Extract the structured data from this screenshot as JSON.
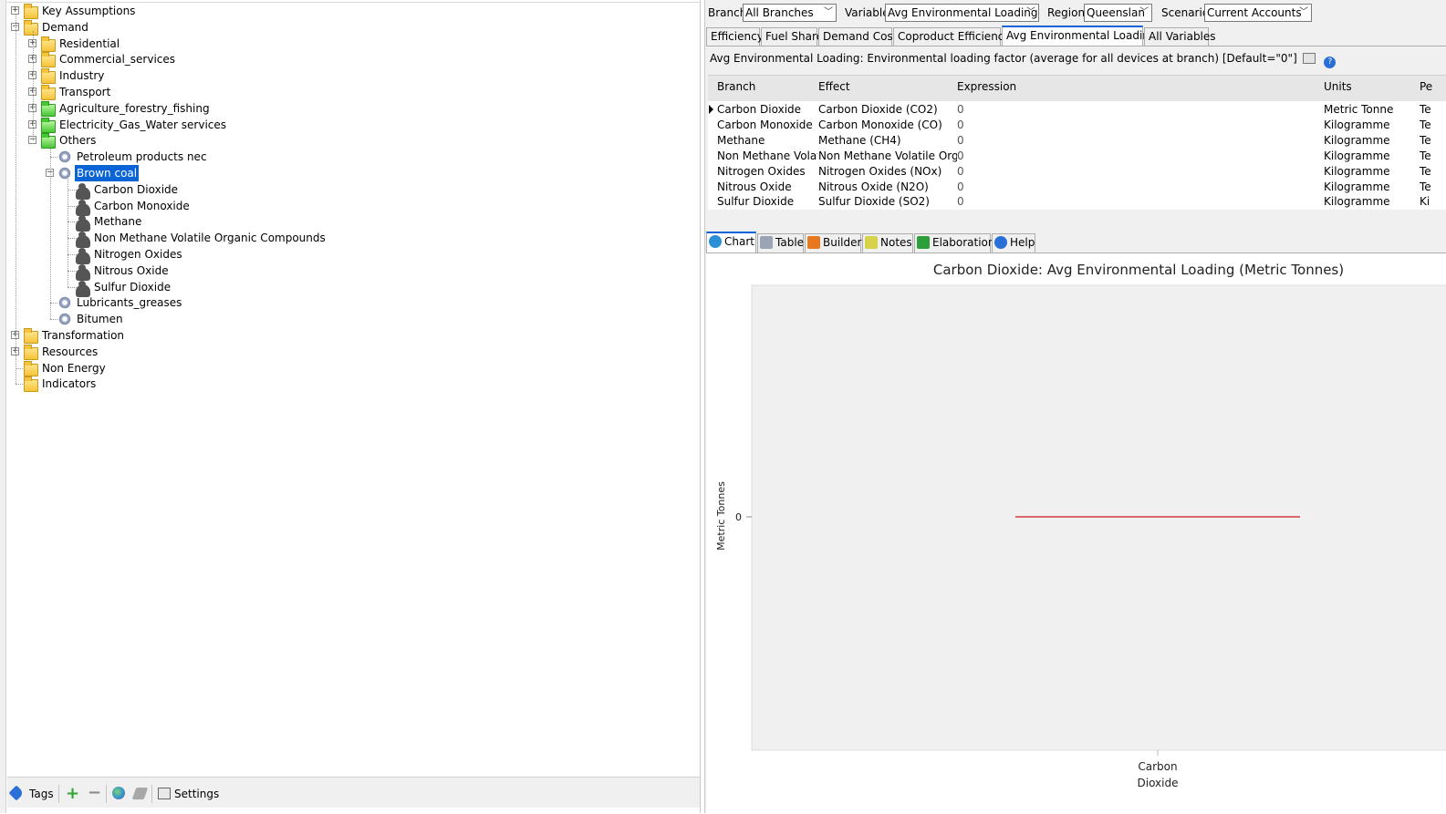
{
  "tree": {
    "items": [
      {
        "label": "Key Assumptions",
        "level": 0,
        "icon": "folder-yellow",
        "expander": "+"
      },
      {
        "label": "Demand",
        "level": 0,
        "icon": "folder-yellow",
        "expander": "-"
      },
      {
        "label": "Residential",
        "level": 1,
        "icon": "folder-yellow",
        "expander": "+"
      },
      {
        "label": "Commercial_services",
        "level": 1,
        "icon": "folder-yellow",
        "expander": "+"
      },
      {
        "label": "Industry",
        "level": 1,
        "icon": "folder-yellow",
        "expander": "+"
      },
      {
        "label": "Transport",
        "level": 1,
        "icon": "folder-yellow",
        "expander": "+"
      },
      {
        "label": "Agriculture_forestry_fishing",
        "level": 1,
        "icon": "folder-green",
        "expander": "+"
      },
      {
        "label": "Electricity_Gas_Water services",
        "level": 1,
        "icon": "folder-green",
        "expander": "+"
      },
      {
        "label": "Others",
        "level": 1,
        "icon": "folder-green",
        "expander": "-"
      },
      {
        "label": "Petroleum products nec",
        "level": 2,
        "icon": "gear",
        "expander": ""
      },
      {
        "label": "Brown coal",
        "level": 2,
        "icon": "gear",
        "expander": "-",
        "selected": true
      },
      {
        "label": "Carbon Dioxide",
        "level": 3,
        "icon": "cloud",
        "expander": ""
      },
      {
        "label": "Carbon Monoxide",
        "level": 3,
        "icon": "cloud",
        "expander": ""
      },
      {
        "label": "Methane",
        "level": 3,
        "icon": "cloud",
        "expander": ""
      },
      {
        "label": "Non Methane Volatile Organic Compounds",
        "level": 3,
        "icon": "cloud",
        "expander": ""
      },
      {
        "label": "Nitrogen Oxides",
        "level": 3,
        "icon": "cloud",
        "expander": ""
      },
      {
        "label": "Nitrous Oxide",
        "level": 3,
        "icon": "cloud",
        "expander": ""
      },
      {
        "label": "Sulfur Dioxide",
        "level": 3,
        "icon": "cloud",
        "expander": ""
      },
      {
        "label": "Lubricants_greases",
        "level": 2,
        "icon": "gear",
        "expander": ""
      },
      {
        "label": "Bitumen",
        "level": 2,
        "icon": "gear",
        "expander": ""
      },
      {
        "label": "Transformation",
        "level": 0,
        "icon": "folder-yellow",
        "expander": "+"
      },
      {
        "label": "Resources",
        "level": 0,
        "icon": "folder-yellow",
        "expander": "+"
      },
      {
        "label": "Non Energy",
        "level": 0,
        "icon": "folder-yellow",
        "expander": ""
      },
      {
        "label": "Indicators",
        "level": 0,
        "icon": "folder-yellow",
        "expander": ""
      }
    ]
  },
  "left_toolbar": {
    "tags_label": "Tags",
    "settings_label": "Settings"
  },
  "selectors": {
    "branch": {
      "label": "Branch:",
      "value": "All Branches"
    },
    "variable": {
      "label": "Variable:",
      "value": "Avg Environmental Loading"
    },
    "region": {
      "label": "Region:",
      "value": "Queenslan"
    },
    "scenario": {
      "label": "Scenario:",
      "value": "Current Accounts"
    }
  },
  "variable_tabs": [
    "Efficiency",
    "Fuel Share",
    "Demand Cost",
    "Coproduct Efficiency",
    "Avg Environmental Loading",
    "All Variables"
  ],
  "active_variable_tab": "Avg Environmental Loading",
  "variable_description": "Avg Environmental Loading: Environmental loading factor (average for all devices at branch) [Default=\"0\"]",
  "grid": {
    "columns": [
      "Branch",
      "Effect",
      "Expression",
      "Units",
      "Pe"
    ],
    "rows": [
      {
        "branch": "Carbon Dioxide",
        "effect": "Carbon Dioxide (CO2)",
        "expression": "0",
        "units": "Metric Tonne",
        "per": "Te"
      },
      {
        "branch": "Carbon Monoxide",
        "effect": "Carbon Monoxide (CO)",
        "expression": "0",
        "units": "Kilogramme",
        "per": "Te"
      },
      {
        "branch": "Methane",
        "effect": "Methane (CH4)",
        "expression": "0",
        "units": "Kilogramme",
        "per": "Te"
      },
      {
        "branch": "Non Methane Volatile",
        "effect": "Non Methane Volatile Organi",
        "expression": "0",
        "units": "Kilogramme",
        "per": "Te"
      },
      {
        "branch": "Nitrogen Oxides",
        "effect": "Nitrogen Oxides (NOx)",
        "expression": "0",
        "units": "Kilogramme",
        "per": "Te"
      },
      {
        "branch": "Nitrous Oxide",
        "effect": "Nitrous Oxide (N2O)",
        "expression": "0",
        "units": "Kilogramme",
        "per": "Te"
      },
      {
        "branch": "Sulfur Dioxide",
        "effect": "Sulfur Dioxide (SO2)",
        "expression": "0",
        "units": "Kilogramme",
        "per": "Ki"
      }
    ]
  },
  "bottom_tabs": [
    {
      "label": "Chart",
      "icon": "chart-icon",
      "color": "#2a8fd8"
    },
    {
      "label": "Table",
      "icon": "table-icon",
      "color": "#9aa4b4"
    },
    {
      "label": "Builder",
      "icon": "builder-icon",
      "color": "#e8781e"
    },
    {
      "label": "Notes",
      "icon": "notes-icon",
      "color": "#d6d24a"
    },
    {
      "label": "Elaboration",
      "icon": "elaboration-icon",
      "color": "#2c9e3a"
    },
    {
      "label": "Help",
      "icon": "help-icon",
      "color": "#2a6fd8"
    }
  ],
  "active_bottom_tab": "Chart",
  "chart_data": {
    "type": "line",
    "title": "Carbon Dioxide: Avg Environmental Loading (Metric Tonnes)",
    "ylabel": "Metric Tonnes",
    "xlabel": "",
    "categories": [
      "Carbon\nDioxide"
    ],
    "series": [
      {
        "values": [
          0
        ],
        "color": "#d33b3b"
      }
    ],
    "y_ticks": [
      0
    ],
    "grid": false
  }
}
